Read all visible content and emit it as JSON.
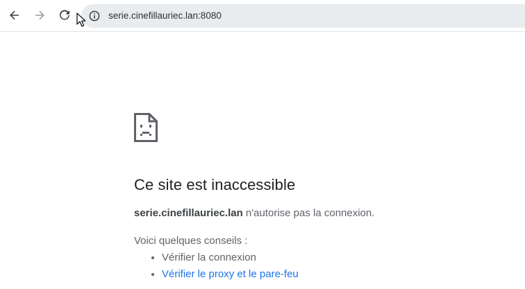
{
  "toolbar": {
    "back_icon": "arrow-left-icon",
    "forward_icon": "arrow-right-icon",
    "reload_icon": "reload-icon",
    "site_info_icon": "info-icon",
    "url": "serie.cinefillauriec.lan:8080"
  },
  "error_page": {
    "icon": "sad-page-icon",
    "title": "Ce site est inaccessible",
    "host": "serie.cinefillauriec.lan",
    "message": " n'autorise pas la connexion.",
    "tips_heading": "Voici quelques conseils :",
    "tips": [
      "Vérifier la connexion",
      "Vérifier le proxy et le pare-feu"
    ]
  },
  "colors": {
    "link": "#1a73e8",
    "text": "#202124",
    "secondary_text": "#5f6368",
    "omnibox_bg": "#e9ecef"
  }
}
